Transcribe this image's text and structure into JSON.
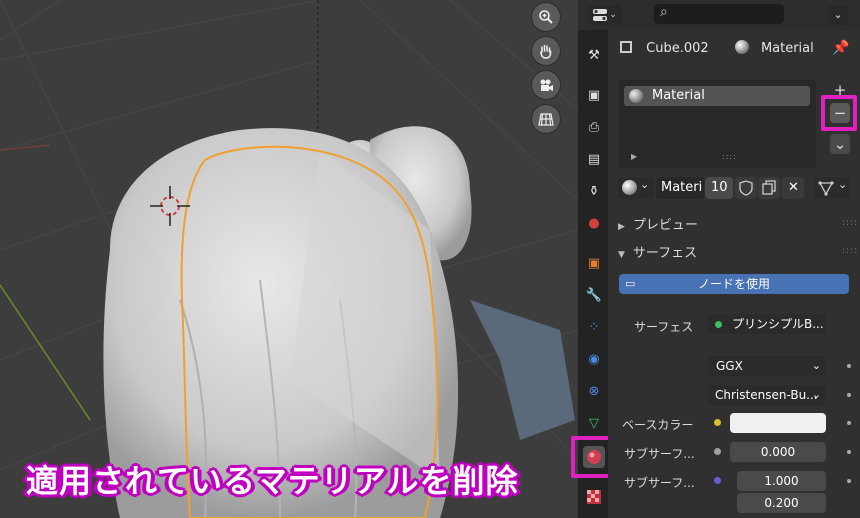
{
  "header": {
    "editor_type_icon": "properties-editor-icon",
    "search_icon": "⌕",
    "dropdown_icon": "⌄"
  },
  "viewport": {
    "nav_icons": [
      "zoom-icon",
      "hand-pan-icon",
      "camera-icon",
      "grid-icon"
    ]
  },
  "caption": "適用されているマテリアルを削除",
  "context": {
    "object_name": "Cube.002",
    "material_name": "Material"
  },
  "slots": {
    "items": [
      {
        "label": "Material"
      }
    ],
    "add_label": "+",
    "remove_label": "−",
    "more_label": "⌄"
  },
  "material_selector": {
    "name": "Materi",
    "users": "10"
  },
  "sections": {
    "preview": "プレビュー",
    "surface": "サーフェス"
  },
  "use_nodes_button": "ノードを使用",
  "surface": {
    "label": "サーフェス",
    "shader": "プリンシプルB...",
    "distribution": "GGX",
    "subsurface_method": "Christensen-Bu...",
    "base_color_label": "ベースカラー",
    "base_color": "#f0f0f0",
    "subsurface_label": "サブサーフ...",
    "subsurface_value": "0.000",
    "subsurface_radius_label": "サブサーフ...",
    "subsurface_radius_1": "1.000",
    "subsurface_radius_2": "0.200"
  },
  "colors": {
    "accent": "#4772b3",
    "highlight": "#e020c0",
    "selection_outline": "#f0a030"
  }
}
